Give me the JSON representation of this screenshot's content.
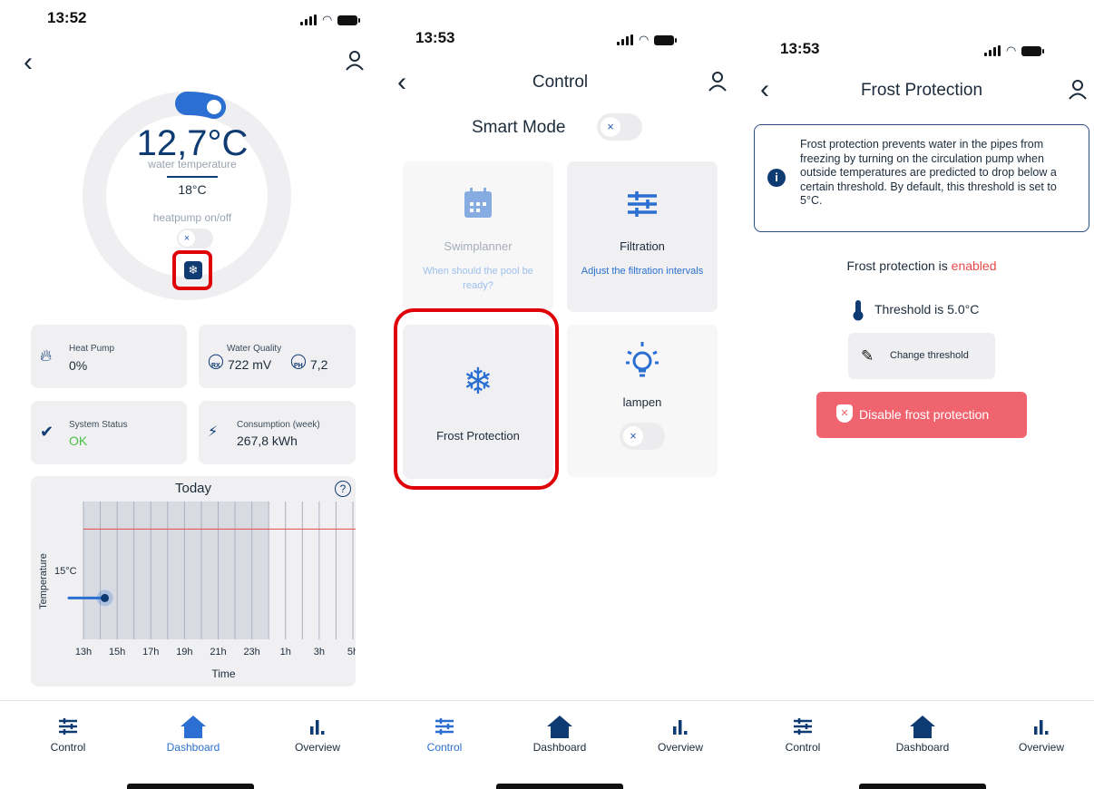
{
  "screen1": {
    "time": "13:52",
    "temperature": "12,7°C",
    "temp_label": "water temperature",
    "setpoint": "18°C",
    "heatpump_label": "heatpump on/off",
    "toggle_symbol": "×",
    "cards": {
      "heat_pump": {
        "title": "Heat Pump",
        "value": "0%"
      },
      "water_quality": {
        "title": "Water Quality",
        "rx_sub": "RX",
        "rx_value": "722 mV",
        "ph_sub": "PH",
        "ph_value": "7,2"
      },
      "system_status": {
        "title": "System Status",
        "value": "OK"
      },
      "consumption": {
        "title": "Consumption (week)",
        "value": "267,8 kWh"
      }
    },
    "chart_title": "Today",
    "help_symbol": "?"
  },
  "chart_data": {
    "type": "line",
    "title": "Today",
    "xlabel": "Time",
    "ylabel": "Temperature",
    "x_ticks": [
      "13h",
      "15h",
      "17h",
      "19h",
      "21h",
      "23h",
      "1h",
      "3h",
      "5h"
    ],
    "y_ticks": [
      "15°C"
    ],
    "series": [
      {
        "values": [
          {
            "x": "13h",
            "y": 13
          },
          {
            "x": "14h",
            "y": 13
          }
        ]
      }
    ],
    "threshold_line": 18,
    "shaded_until": "0h",
    "ylim": [
      10,
      20
    ],
    "colors": {
      "line": "#2a6fd1",
      "threshold": "#e84a4a",
      "shade": "#d9dbe2"
    }
  },
  "screen2": {
    "time": "13:53",
    "title": "Control",
    "smart_mode_label": "Smart Mode",
    "toggle_symbol": "×",
    "tiles": {
      "swimplanner": {
        "title": "Swimplanner",
        "desc": "When should the pool be ready?"
      },
      "filtration": {
        "title": "Filtration",
        "desc": "Adjust the filtration intervals"
      },
      "frost": {
        "title": "Frost Protection"
      },
      "lampen": {
        "title": "lampen"
      }
    }
  },
  "screen3": {
    "time": "13:53",
    "title": "Frost Protection",
    "info_text": "Frost protection prevents water in the pipes from freezing by turning on the circulation pump when outside temperatures are predicted to drop below a certain threshold. By default, this threshold is set to 5°C.",
    "status_prefix": "Frost protection is ",
    "status_value": "enabled",
    "threshold_text": "Threshold is 5.0°C",
    "change_button": "Change threshold",
    "disable_button": "Disable frost protection"
  },
  "tabs": {
    "control": "Control",
    "dashboard": "Dashboard",
    "overview": "Overview"
  },
  "colors": {
    "accent": "#2a6fd1",
    "dark_blue": "#0f3b73",
    "red": "#e00008",
    "danger_button": "#f0646f",
    "enabled": "#e84a4a",
    "ok_green": "#48c04a"
  }
}
